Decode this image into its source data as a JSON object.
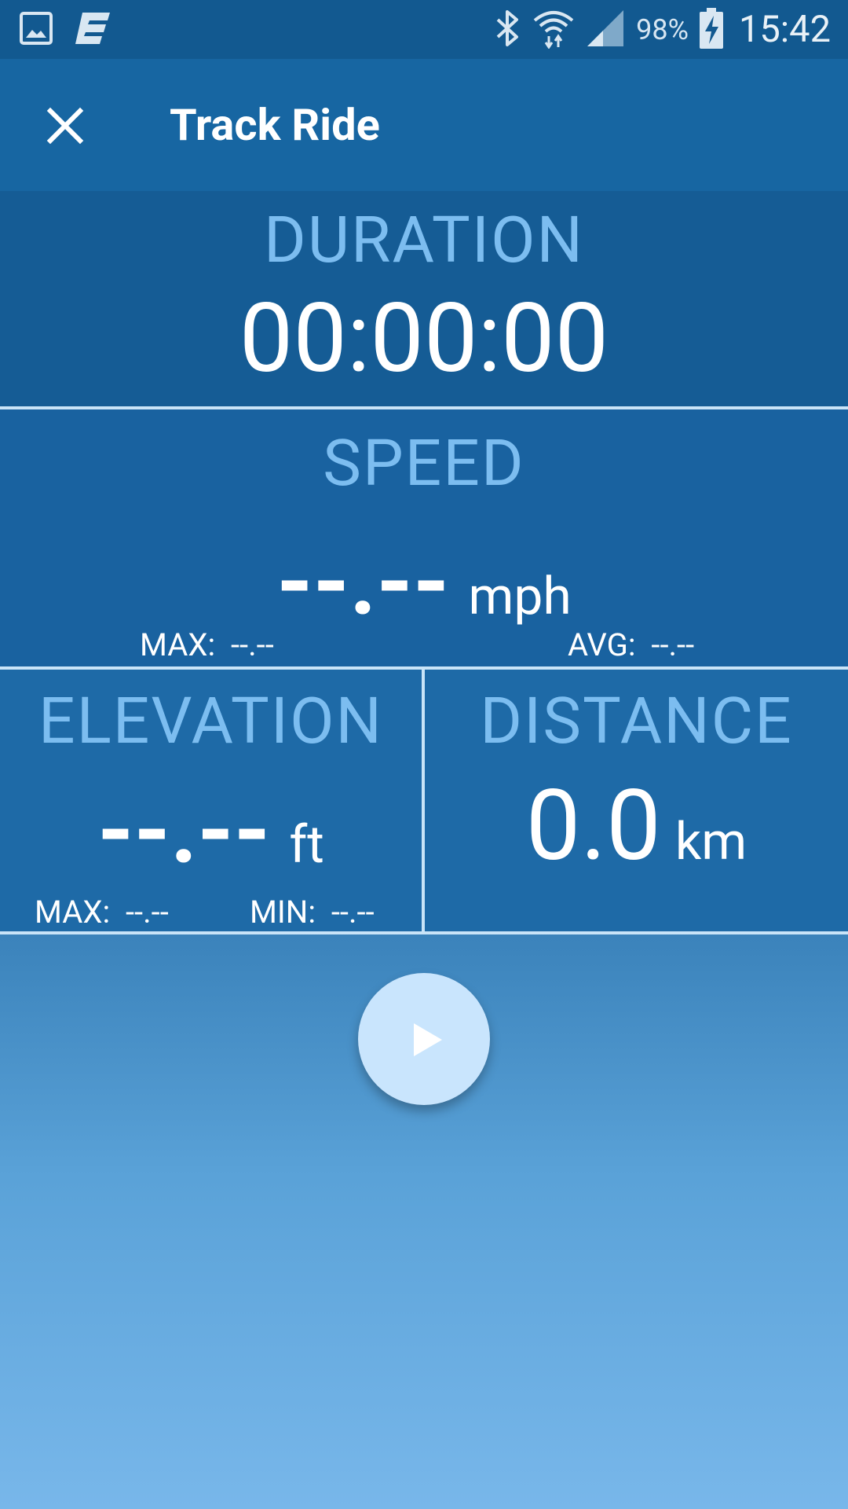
{
  "status_bar": {
    "left_icons": [
      "gallery-icon",
      "app-logo-icon"
    ],
    "right_icons": [
      "bluetooth-icon",
      "wifi-icon",
      "signal-icon",
      "battery-charging-icon"
    ],
    "battery_percent": "98%",
    "time": "15:42"
  },
  "app_bar": {
    "close_icon": "close-icon",
    "title": "Track Ride"
  },
  "duration": {
    "label": "DURATION",
    "value": "00:00:00"
  },
  "speed": {
    "label": "SPEED",
    "value": "--.--",
    "unit": "mph",
    "max_label": "MAX:",
    "max_value": "--.--",
    "avg_label": "AVG:",
    "avg_value": "--.--"
  },
  "elevation": {
    "label": "ELEVATION",
    "value": "--.--",
    "unit": "ft",
    "max_label": "MAX:",
    "max_value": "--.--",
    "min_label": "MIN:",
    "min_value": "--.--"
  },
  "distance": {
    "label": "DISTANCE",
    "value": "0.0",
    "unit": "km"
  },
  "controls": {
    "play_icon": "play-icon"
  },
  "colors": {
    "status_bar": "#125990",
    "app_bar": "#1766a2",
    "label_text": "#7cbdf0",
    "divider": "#c9e4f8",
    "play_button": "#c9e5fd"
  }
}
